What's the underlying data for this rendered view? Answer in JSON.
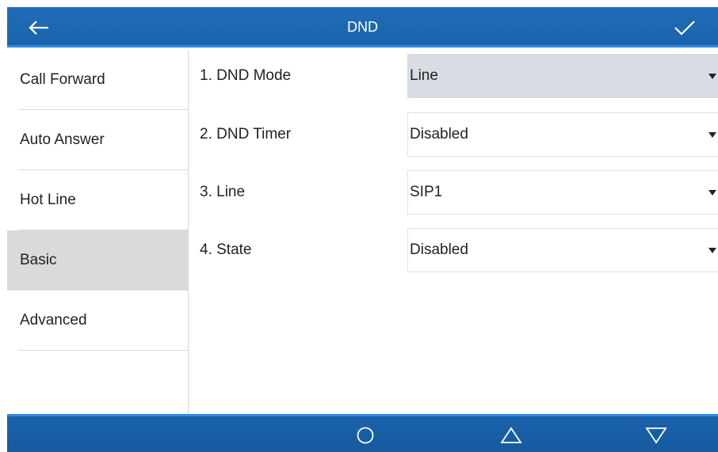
{
  "header": {
    "title": "DND",
    "back_icon": "back-arrow-icon",
    "confirm_icon": "checkmark-icon"
  },
  "sidebar": {
    "items": [
      {
        "label": "Call Forward",
        "active": false
      },
      {
        "label": "Auto Answer",
        "active": false
      },
      {
        "label": "Hot Line",
        "active": false
      },
      {
        "label": "Basic",
        "active": true
      },
      {
        "label": "Advanced",
        "active": false
      }
    ]
  },
  "settings": {
    "rows": [
      {
        "label": "1. DND Mode",
        "value": "Line",
        "focused": true
      },
      {
        "label": "2. DND Timer",
        "value": "Disabled",
        "focused": false
      },
      {
        "label": "3. Line",
        "value": "SIP1",
        "focused": false
      },
      {
        "label": "4. State",
        "value": "Disabled",
        "focused": false
      }
    ]
  },
  "navbar": {
    "buttons": [
      "home-circle-icon",
      "triangle-up-icon",
      "triangle-down-icon"
    ]
  },
  "colors": {
    "header_bg": "#1f6cb5",
    "accent": "#2f8be0",
    "active_item_bg": "#dadadb",
    "focused_select_bg": "#d8dde3"
  }
}
